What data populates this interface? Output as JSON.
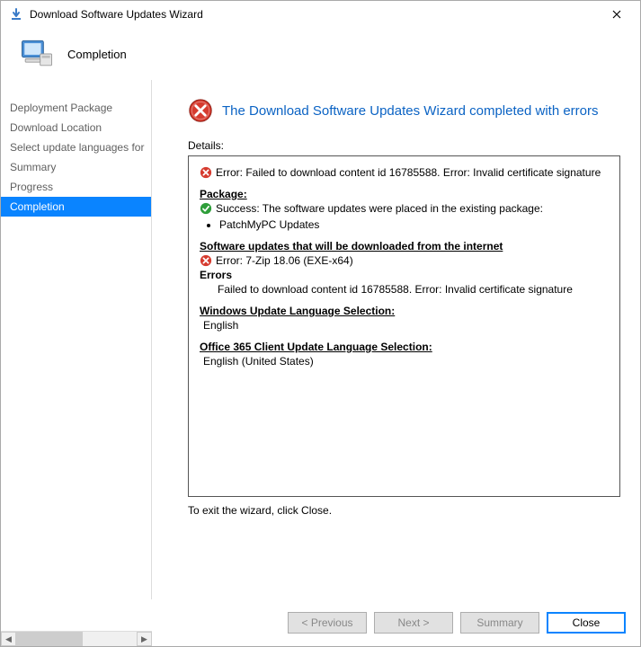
{
  "window": {
    "title": "Download Software Updates Wizard"
  },
  "header": {
    "page_title": "Completion"
  },
  "sidebar": {
    "items": [
      {
        "label": "Deployment Package",
        "selected": false
      },
      {
        "label": "Download Location",
        "selected": false
      },
      {
        "label": "Select update languages for",
        "selected": false
      },
      {
        "label": "Summary",
        "selected": false
      },
      {
        "label": "Progress",
        "selected": false
      },
      {
        "label": "Completion",
        "selected": true
      }
    ]
  },
  "completion": {
    "message": "The Download Software Updates Wizard completed with errors",
    "details_label": "Details:",
    "top_error": "Error: Failed to download content id 16785588. Error: Invalid certificate signature",
    "package": {
      "heading": "Package:",
      "success_line": "Success: The software updates were placed in the existing package:",
      "package_name": "PatchMyPC Updates"
    },
    "downloads": {
      "heading": "Software updates that will be downloaded from the internet",
      "error_item": "Error: 7-Zip 18.06 (EXE-x64)",
      "errors_label": "Errors",
      "error_detail": "Failed to download content id 16785588. Error: Invalid certificate signature"
    },
    "win_lang": {
      "heading": "Windows Update Language Selection:",
      "value": "English"
    },
    "o365_lang": {
      "heading": "Office 365 Client Update Language Selection:",
      "value": "English (United States)"
    },
    "exit_hint": "To exit the wizard, click Close."
  },
  "buttons": {
    "previous": "< Previous",
    "next": "Next >",
    "summary": "Summary",
    "close": "Close"
  }
}
